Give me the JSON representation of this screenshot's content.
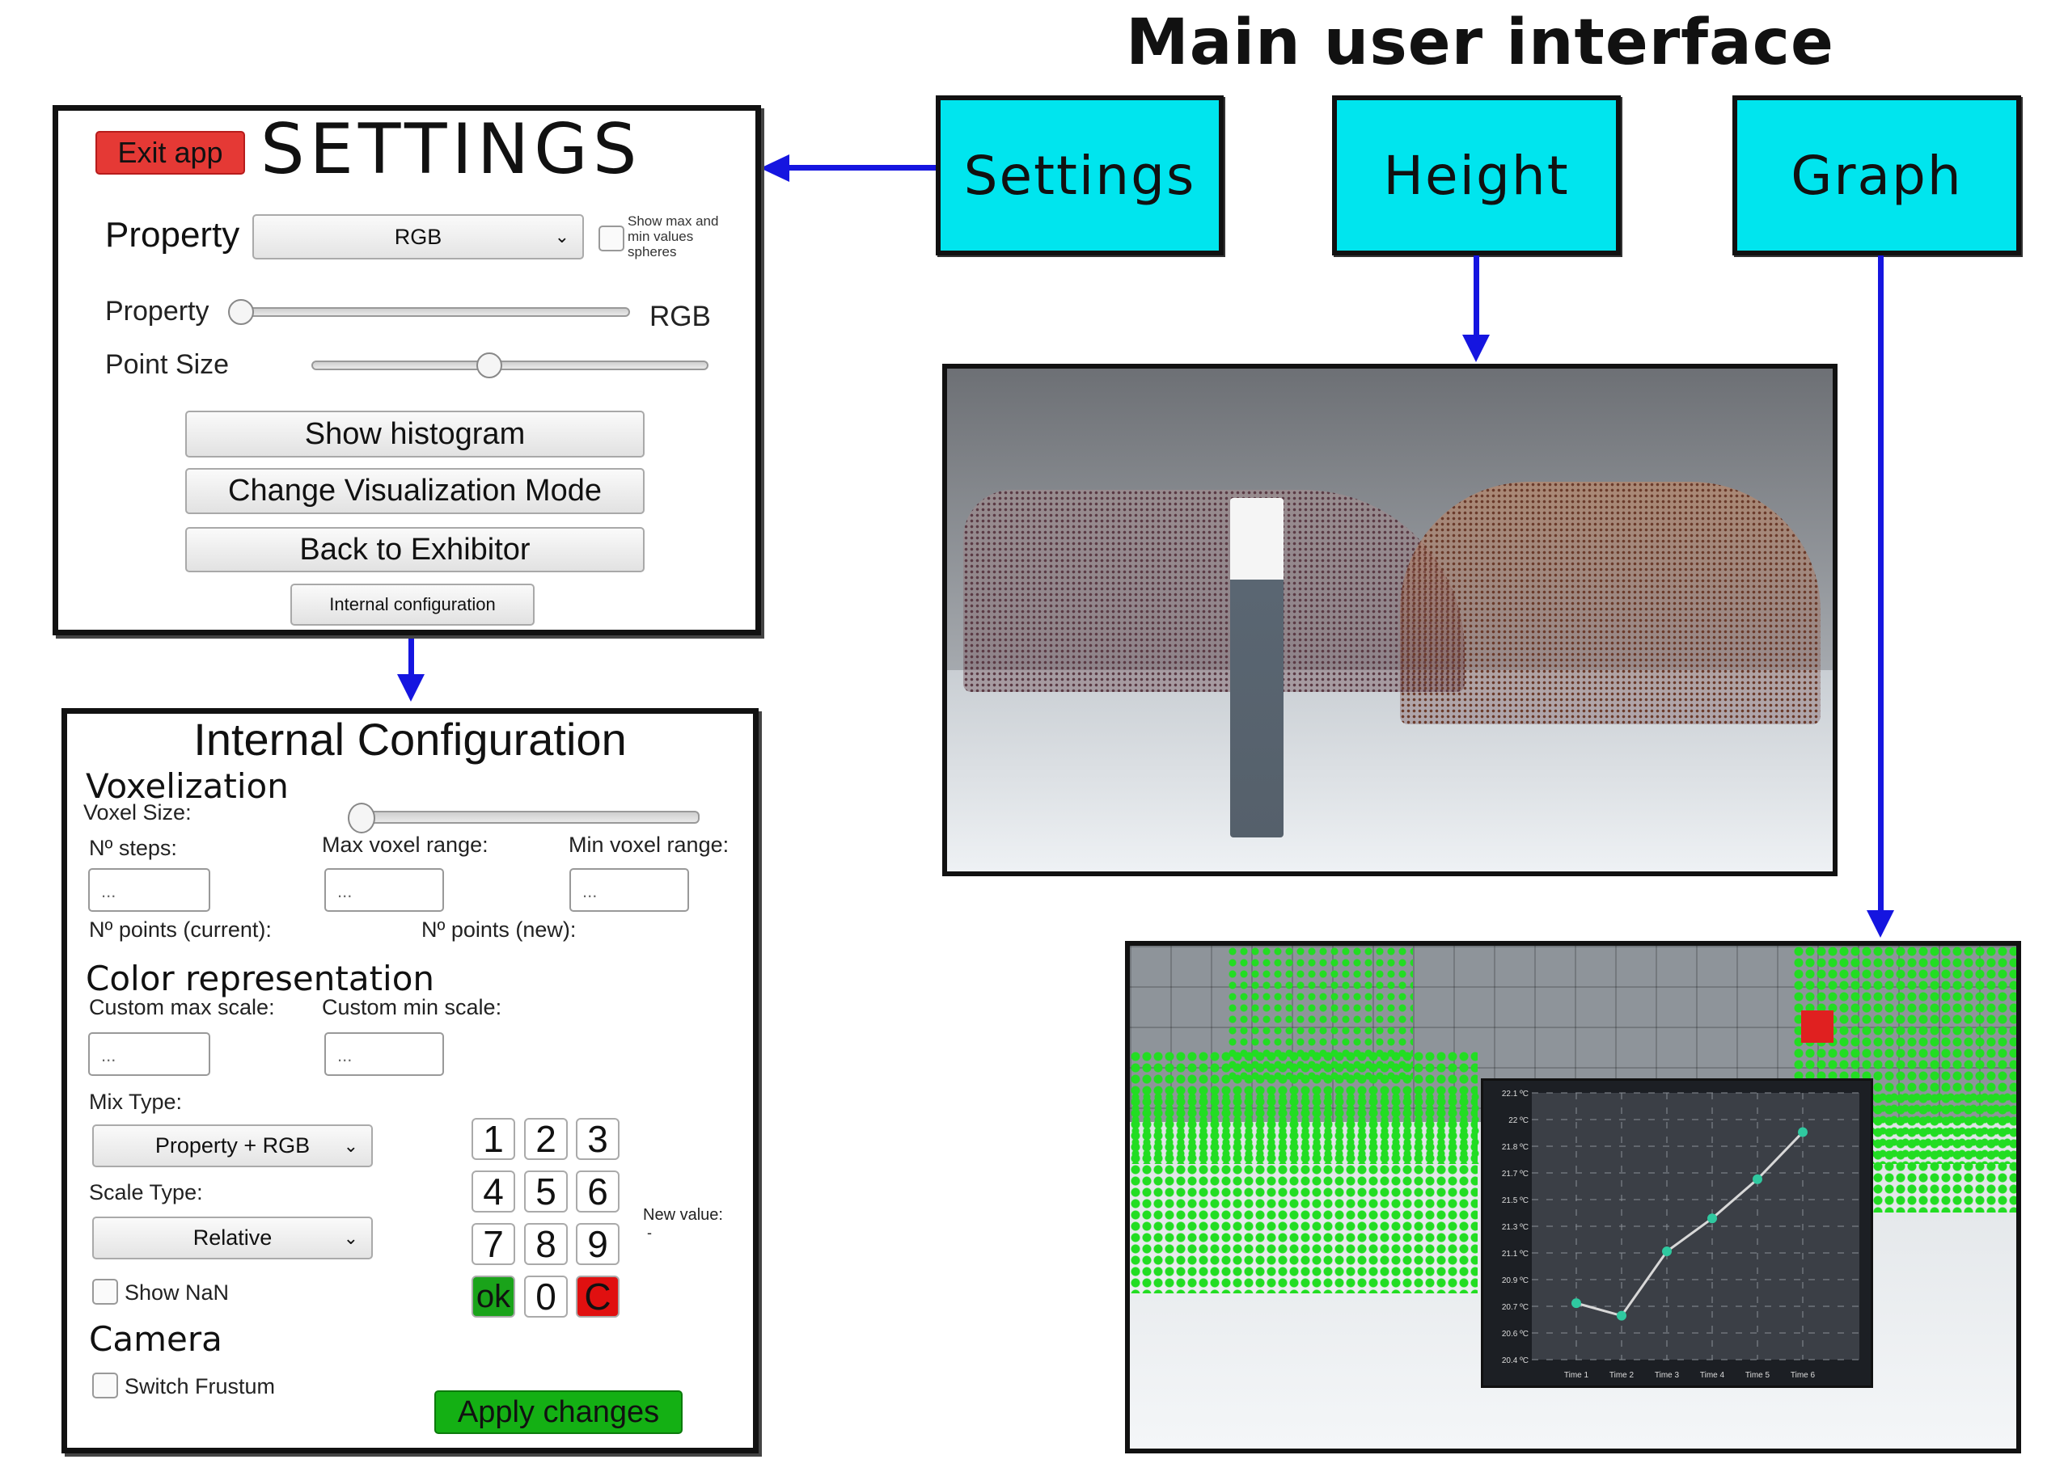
{
  "header": {
    "title": "Main user interface"
  },
  "nav": {
    "settings": "Settings",
    "height": "Height",
    "graph": "Graph"
  },
  "colors": {
    "nav_box": "#00e5ee",
    "arrow": "#1515e0",
    "exit": "#e53935",
    "ok": "#1aa31a",
    "clear": "#e01010",
    "apply": "#14b014",
    "point_cloud_green": "#22dd22"
  },
  "settings": {
    "exit_label": "Exit app",
    "title": "SETTINGS",
    "property_label": "Property",
    "property_value": "RGB",
    "show_spheres_label": "Show max and min values spheres",
    "show_spheres_checked": false,
    "property_slider_label": "Property",
    "property_slider_value_label": "RGB",
    "property_slider_level": 0,
    "point_size_label": "Point Size",
    "point_size_level": 0.45,
    "buttons": [
      "Show histogram",
      "Change Visualization Mode",
      "Back to Exhibitor"
    ],
    "internal_button": "Internal configuration"
  },
  "internal": {
    "title": "Internal Configuration",
    "voxelization": "Voxelization",
    "voxel_size": "Voxel Size:",
    "voxel_size_level": 0,
    "steps_label": "Nº steps:",
    "max_range_label": "Max voxel range:",
    "min_range_label": "Min voxel range:",
    "placeholder": "...",
    "points_current": "Nº points (current):",
    "points_new": "Nº points (new):",
    "color_rep": "Color representation",
    "custom_max": "Custom max scale:",
    "custom_min": "Custom min scale:",
    "mix_type_label": "Mix Type:",
    "mix_type_value": "Property + RGB",
    "scale_type_label": "Scale Type:",
    "scale_type_value": "Relative",
    "show_nan": "Show NaN",
    "camera": "Camera",
    "switch_frustum": "Switch Frustum",
    "keys": [
      "1",
      "2",
      "3",
      "4",
      "5",
      "6",
      "7",
      "8",
      "9",
      "ok",
      "0",
      "C"
    ],
    "new_value_label": "New value:",
    "new_value": "-",
    "apply": "Apply changes"
  },
  "chart_data": {
    "type": "line",
    "categories": [
      "Time 1",
      "Time 2",
      "Time 3",
      "Time 4",
      "Time 5",
      "Time 6"
    ],
    "values": [
      20.76,
      20.68,
      21.09,
      21.3,
      21.55,
      21.85
    ],
    "y_tick_labels": [
      "22.1 ºC",
      "22 ºC",
      "21.8 ºC",
      "21.7 ºC",
      "21.5 ºC",
      "21.3 ºC",
      "21.1 ºC",
      "20.9 ºC",
      "20.7 ºC",
      "20.6 ºC",
      "20.4 ºC"
    ],
    "ylim": [
      20.4,
      22.1
    ],
    "grid": true,
    "line_color": "#d8d8d8",
    "marker_color": "#2fc9a0",
    "background": "#3b3f46"
  }
}
